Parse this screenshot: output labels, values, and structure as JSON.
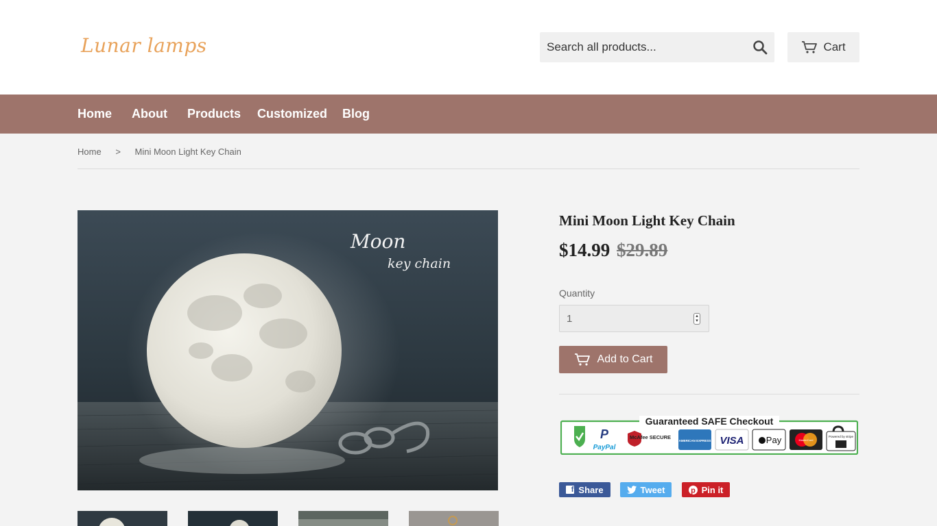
{
  "header": {
    "logo": "Lunar lamps",
    "search_placeholder": "Search all products...",
    "cart_label": "Cart"
  },
  "nav": {
    "items": [
      {
        "label": "Home"
      },
      {
        "label": "About"
      },
      {
        "label": "Products"
      },
      {
        "label": "Customized"
      },
      {
        "label": "Blog"
      }
    ]
  },
  "breadcrumb": {
    "home": "Home",
    "separator": ">",
    "current": "Mini Moon Light Key Chain"
  },
  "product": {
    "image_text_1": "Moon",
    "image_text_2": "key chain",
    "title": "Mini Moon Light Key Chain",
    "price": "$14.99",
    "compare_price": "$29.89",
    "quantity_label": "Quantity",
    "quantity_value": "1",
    "add_to_cart": "Add to Cart"
  },
  "safe_checkout": {
    "heading": "Guaranteed SAFE Checkout",
    "badges": [
      "PayPal",
      "McAfee SECURE",
      "AMERICAN EXPRESS",
      "VISA",
      "Pay",
      "MasterCard",
      "Powered by stripe"
    ]
  },
  "social": {
    "share": "Share",
    "tweet": "Tweet",
    "pin": "Pin it"
  },
  "colors": {
    "nav_bg": "#9e746b",
    "accent": "#9e746b",
    "facebook": "#3b5998",
    "twitter": "#55acee",
    "pinterest": "#cb2027",
    "safe_green": "#4caf50"
  }
}
